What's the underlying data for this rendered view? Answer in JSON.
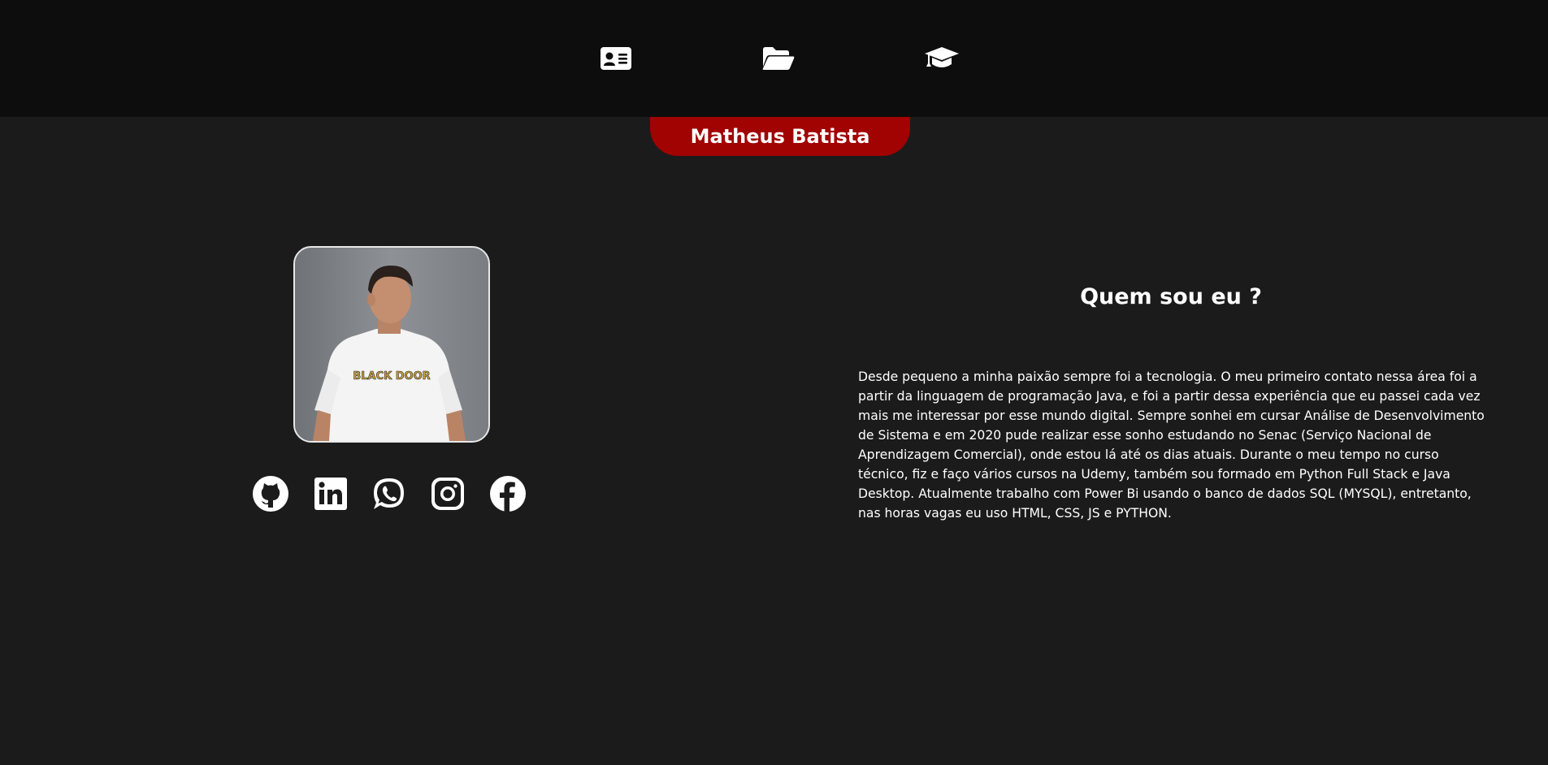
{
  "nav": {
    "items": [
      {
        "icon": "id-card-icon",
        "label": "Sobre"
      },
      {
        "icon": "folder-open-icon",
        "label": "Projetos"
      },
      {
        "icon": "graduation-cap-icon",
        "label": "Formação"
      }
    ]
  },
  "profile": {
    "name": "Matheus Batista",
    "shirt_text": "BLACK DOOR"
  },
  "socials": [
    {
      "icon": "github-icon",
      "name": "GitHub"
    },
    {
      "icon": "linkedin-icon",
      "name": "LinkedIn"
    },
    {
      "icon": "whatsapp-icon",
      "name": "WhatsApp"
    },
    {
      "icon": "instagram-icon",
      "name": "Instagram"
    },
    {
      "icon": "facebook-icon",
      "name": "Facebook"
    }
  ],
  "about": {
    "title": "Quem sou eu ?",
    "text": "Desde pequeno a minha paixão sempre foi a tecnologia. O meu primeiro contato nessa área foi a partir da linguagem de programação Java, e foi a partir dessa experiência que eu passei cada vez mais me interessar por esse mundo digital. Sempre sonhei em cursar Análise de Desenvolvimento de Sistema e em 2020 pude realizar esse sonho estudando no Senac (Serviço Nacional de Aprendizagem Comercial), onde estou lá até os dias atuais. Durante o meu tempo no curso técnico, fiz e faço vários cursos na Udemy, também sou formado em Python Full Stack e Java Desktop. Atualmente trabalho com Power Bi usando o banco de dados SQL (MYSQL), entretanto, nas horas vagas eu uso HTML, CSS, JS e PYTHON."
  },
  "colors": {
    "background": "#1c1b1c",
    "topbar": "#0d0d0d",
    "accent": "#a10202",
    "text": "#ffffff"
  }
}
